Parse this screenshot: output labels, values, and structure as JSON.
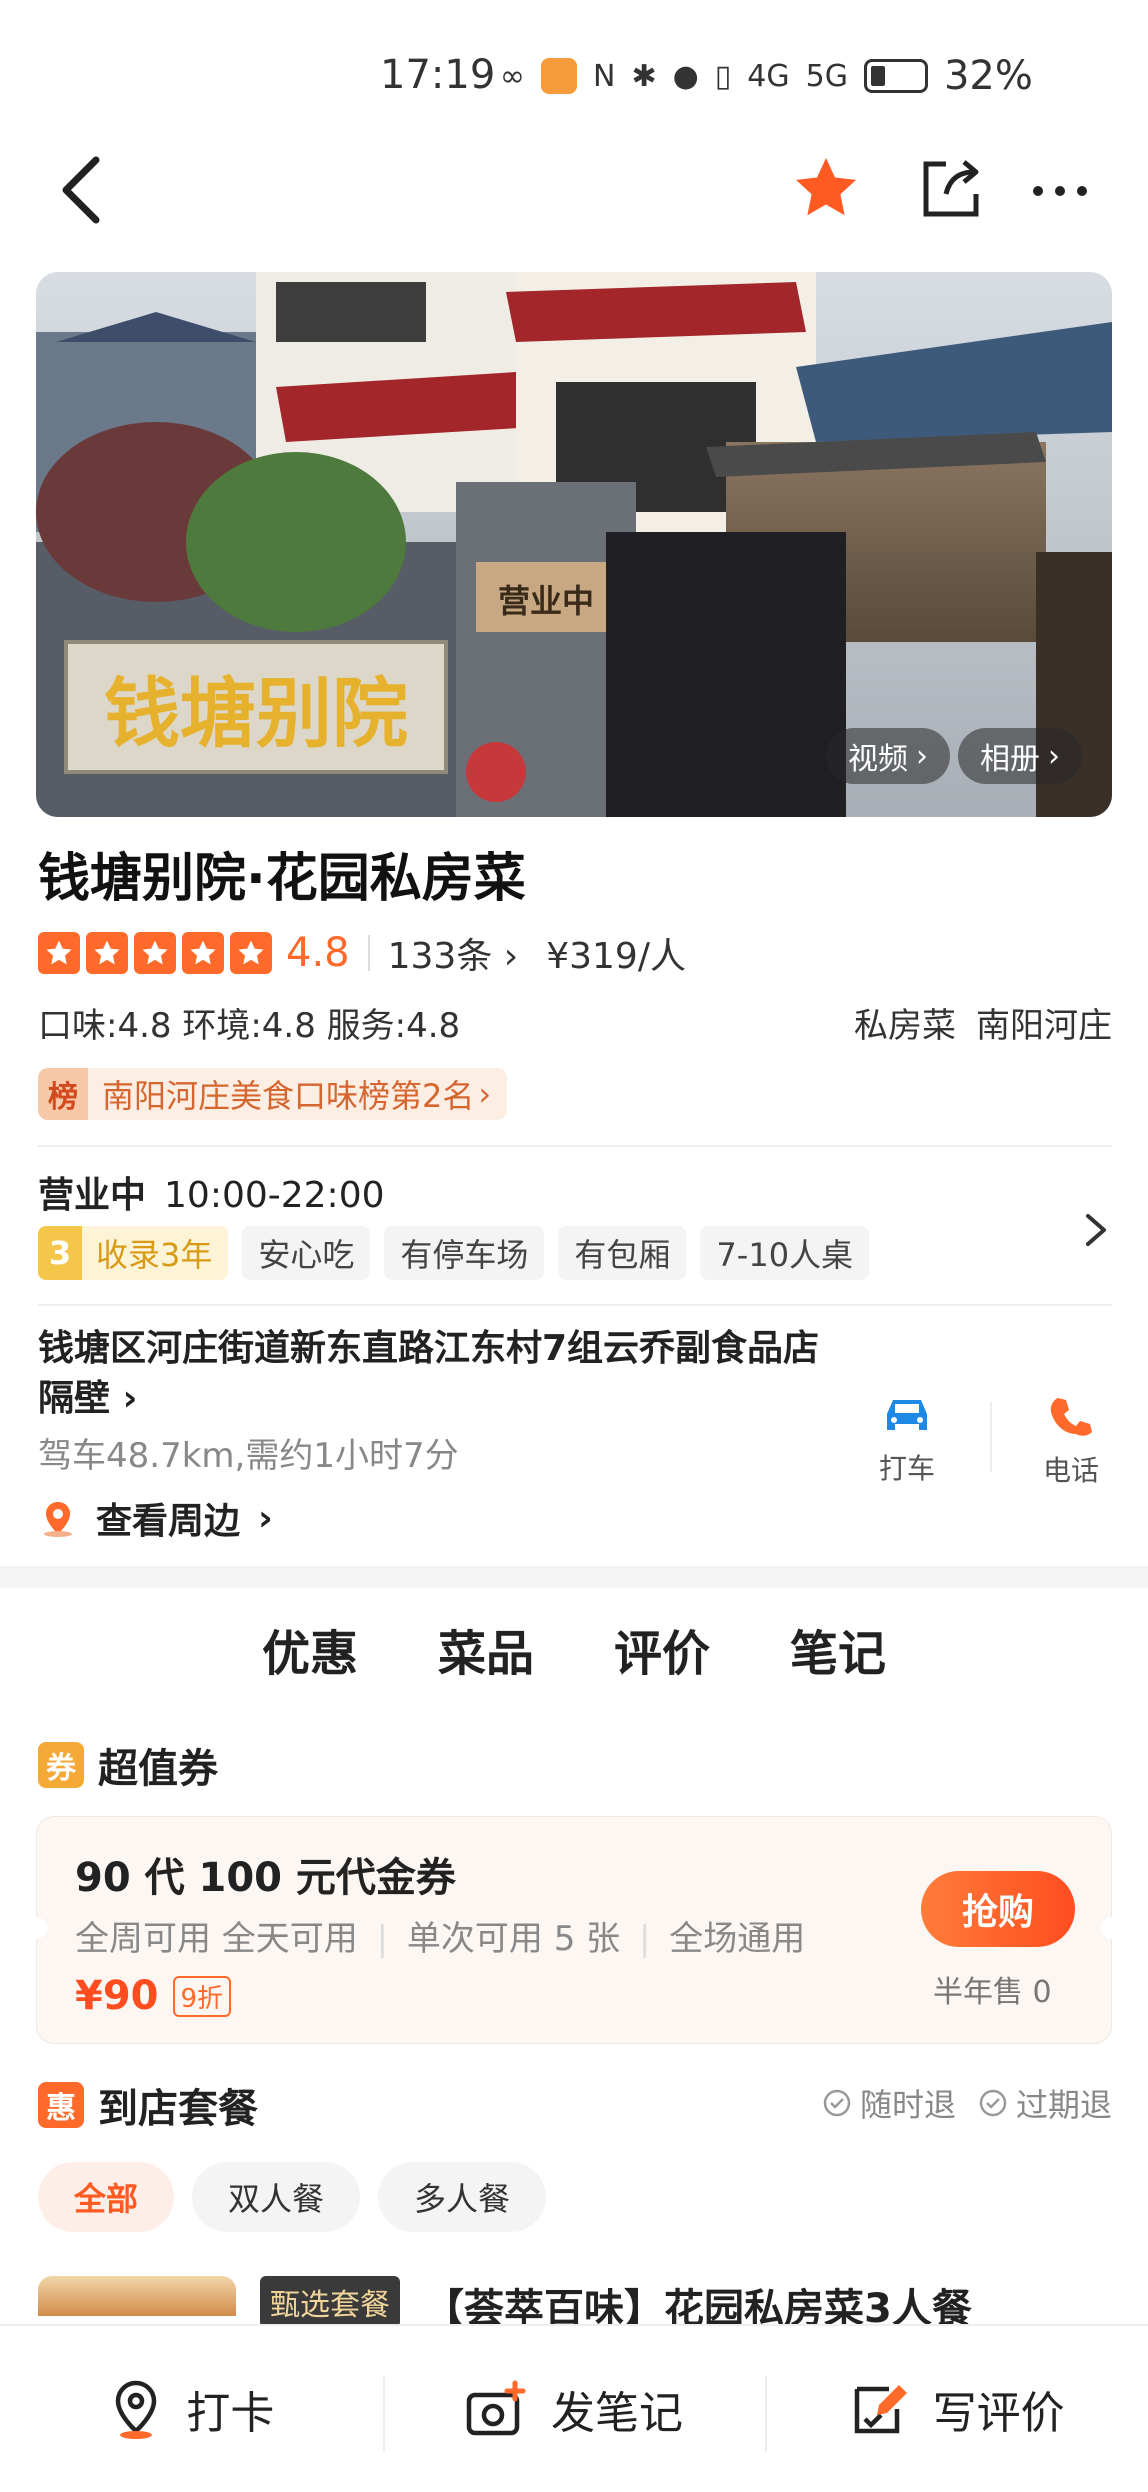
{
  "status": {
    "time": "17:19",
    "battery": "32%",
    "network": [
      "4G",
      "5G"
    ]
  },
  "hero": {
    "sign_text": "钱塘别院",
    "plaque_text": "营业中",
    "video_label": "视频",
    "album_label": "相册"
  },
  "shop": {
    "title": "钱塘别院·花园私房菜",
    "rating": "4.8",
    "stars": 5,
    "reviews": "133条",
    "price": "¥319/人",
    "scores": "口味:4.8  环境:4.8  服务:4.8",
    "cuisine": "私房菜",
    "area": "南阳河庄",
    "rank_icon": "榜",
    "rank_text": "南阳河庄美食口味榜第2名"
  },
  "hours": {
    "status": "营业中",
    "time": "10:00-22:00"
  },
  "features": {
    "years_num": "3",
    "years_label": "收录3年",
    "tags": [
      "安心吃",
      "有停车场",
      "有包厢",
      "7-10人桌"
    ]
  },
  "location": {
    "address": "钱塘区河庄街道新东直路江东村7组云乔副食品店隔壁",
    "distance": "驾车48.7km,需约1小时7分",
    "nearby": "查看周边",
    "taxi_label": "打车",
    "phone_label": "电话"
  },
  "tabs": [
    "优惠",
    "菜品",
    "评价",
    "笔记"
  ],
  "coupon_section": {
    "badge": "券",
    "title": "超值券"
  },
  "coupon": {
    "title": "90 代 100 元代金券",
    "desc": [
      "全周可用 全天可用",
      "单次可用 5 张",
      "全场通用"
    ],
    "price": "¥90",
    "discount": "9折",
    "button": "抢购",
    "sold": "半年售 0"
  },
  "set_section": {
    "badge": "惠",
    "title": "到店套餐",
    "refund_anytime": "随时退",
    "refund_expired": "过期退"
  },
  "filters": [
    "全部",
    "双人餐",
    "多人餐"
  ],
  "meal": {
    "tag": "甄选套餐",
    "title": "【荟萃百味】花园私房菜3人餐"
  },
  "bottom": {
    "checkin": "打卡",
    "note": "发笔记",
    "review": "写评价"
  },
  "colors": {
    "accent": "#ff6a2b",
    "accent_dark": "#ff4d1f",
    "taxi_blue": "#1e88e5",
    "rank_text": "#d5662f"
  }
}
